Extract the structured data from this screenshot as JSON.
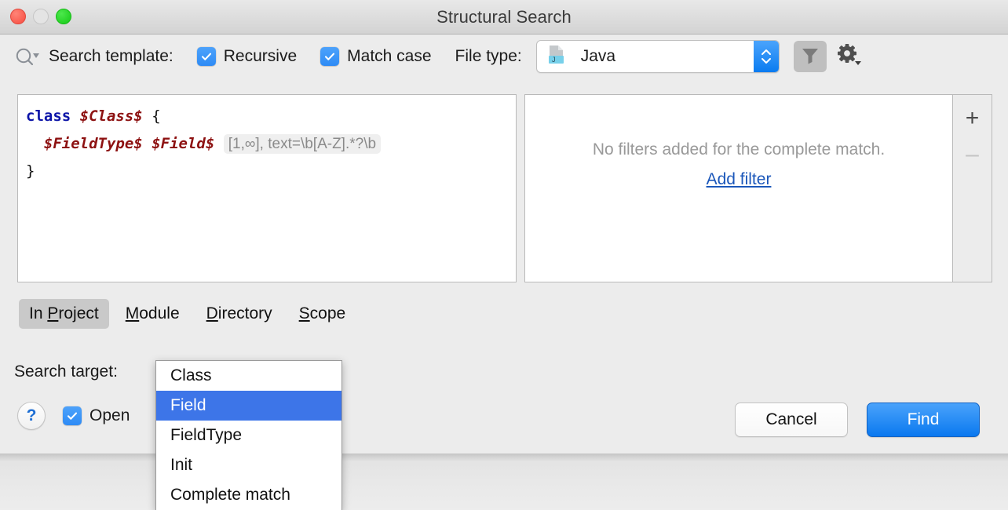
{
  "window": {
    "title": "Structural Search",
    "traffic_lights": [
      "close-red",
      "minimize-disabled",
      "zoom-green"
    ]
  },
  "toolbar": {
    "search_icon": "search-dropdown-icon",
    "search_template_label": "Search template:",
    "recursive": {
      "label": "Recursive",
      "checked": true
    },
    "match_case": {
      "label": "Match case",
      "checked": true
    },
    "file_type_label": "File type:",
    "file_type_value": "Java",
    "file_type_icon": "java-file-icon",
    "filter_button_icon": "funnel-icon",
    "settings_button_icon": "gear-dropdown-icon"
  },
  "editor": {
    "lines": [
      {
        "tokens": [
          {
            "text": "class",
            "kind": "keyword"
          },
          {
            "text": " ",
            "kind": "plain"
          },
          {
            "text": "$Class$",
            "kind": "variable"
          },
          {
            "text": " ",
            "kind": "plain"
          },
          {
            "text": "{",
            "kind": "brace"
          }
        ]
      },
      {
        "tokens": [
          {
            "text": "  ",
            "kind": "plain"
          },
          {
            "text": "$FieldType$",
            "kind": "variable"
          },
          {
            "text": " ",
            "kind": "plain"
          },
          {
            "text": "$Field$",
            "kind": "variable"
          },
          {
            "text": " ",
            "kind": "plain"
          },
          {
            "text": "[1,∞], text=\\b[A-Z].*?\\b",
            "kind": "annotation"
          }
        ]
      },
      {
        "tokens": [
          {
            "text": "}",
            "kind": "brace"
          }
        ]
      }
    ]
  },
  "filters": {
    "empty_message": "No filters added for the complete match.",
    "add_link": "Add filter",
    "add_button": "+",
    "remove_button": "–"
  },
  "scope": {
    "tabs": [
      {
        "label": "In Project",
        "mnemonic": "P",
        "active": true
      },
      {
        "label": "Module",
        "mnemonic": "M",
        "active": false
      },
      {
        "label": "Directory",
        "mnemonic": "D",
        "active": false
      },
      {
        "label": "Scope",
        "mnemonic": "S",
        "active": false
      }
    ]
  },
  "bottom": {
    "search_target_label": "Search target:",
    "help_button": "?",
    "open_checkbox": {
      "label": "Open",
      "checked": true
    },
    "cancel_label": "Cancel",
    "find_label": "Find"
  },
  "dropdown": {
    "items": [
      {
        "label": "Class",
        "selected": false
      },
      {
        "label": "Field",
        "selected": true
      },
      {
        "label": "FieldType",
        "selected": false
      },
      {
        "label": "Init",
        "selected": false
      },
      {
        "label": "Complete match",
        "selected": false
      }
    ]
  },
  "colors": {
    "accent_blue": "#2e8bf5",
    "selection_blue": "#3d75e8",
    "keyword": "#0d15a8",
    "variable": "#8d1111",
    "link": "#1b57ba",
    "annotation_text": "#8a8a8a"
  }
}
